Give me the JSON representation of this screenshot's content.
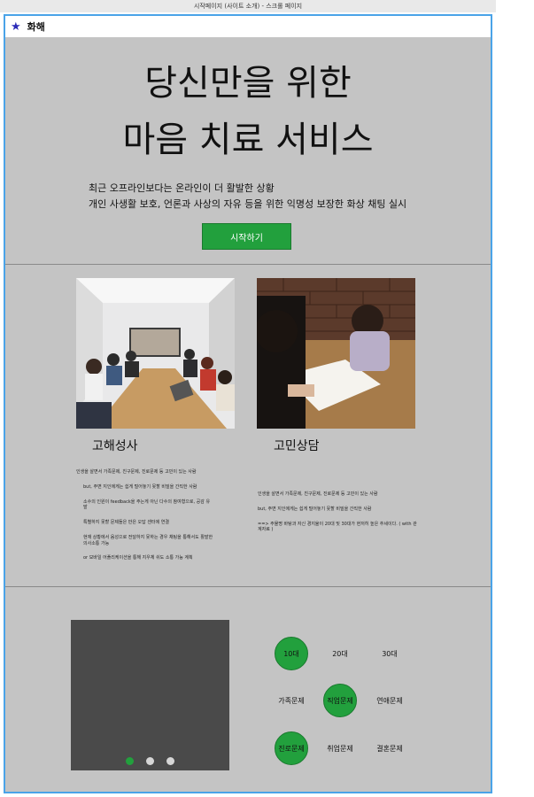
{
  "window": {
    "title": "시작페이지 (사이트 소개) - 스크롤 페이지"
  },
  "header": {
    "logo_icon": "star-icon",
    "logo_text": "화해"
  },
  "hero": {
    "headline_line1": "당신만을 위한",
    "headline_line2": "마음 치료 서비스",
    "sub_line1": "최근 오프라인보다는 온라인이 더 활발한 상황",
    "sub_line2": "개인 사생활 보호, 언론과 사상의 자유 등을 위한 익명성 보장한 화상 채팅 실시",
    "cta_label": "시작하기"
  },
  "services": [
    {
      "title": "고해성사",
      "desc": [
        "인생을 살면서 가족문제, 친구문제, 진로문제 등 고민이 있는 사람",
        "but, 주변 지인에게는 쉽게 털어놓기 못할 비밀을 간직한 사람",
        "소수의 인원이 feedback을 주는게 아닌 다수의 참여형으로, 공감 유발",
        "특별하지 못할 문제들은 만은 오답 센터에 연결",
        "현재 상황에서 음성으로 전달하지 못하는 경우 채팅을 통해서도 활발한 의사소통 가능",
        "or 모바일 어플리케이션을 통해 지우체 쉬도 소통 가능 계획"
      ]
    },
    {
      "title": "고민상담",
      "desc": [
        "인생을 살면서 가족문제, 친구문제, 진로문제 등 고민이 있는 사람",
        "but, 주변 지인에게는 쉽게 털어놓기 못할 비밀을 간직한 사람",
        "==> 주물명 바탕과 자신 경지율이 20대 및 30대가 현저히 높은 추세이다. ( with 관계자료 )"
      ]
    }
  ],
  "slider": {
    "dots": 3,
    "active_index": 0
  },
  "tags": {
    "t_10s": "10대",
    "t_20s": "20대",
    "t_30s": "30대",
    "t_family": "가족문제",
    "t_work": "직업문제",
    "t_love": "연애문제",
    "t_career": "진로문제",
    "t_job": "취업문제",
    "t_marriage": "결혼문제"
  },
  "colors": {
    "accent": "#22a03d",
    "frame_border": "#4aa3e8",
    "background": "#c4c4c4",
    "slider_bg": "#4a4a4a",
    "logo_icon": "#2b2bb8"
  }
}
